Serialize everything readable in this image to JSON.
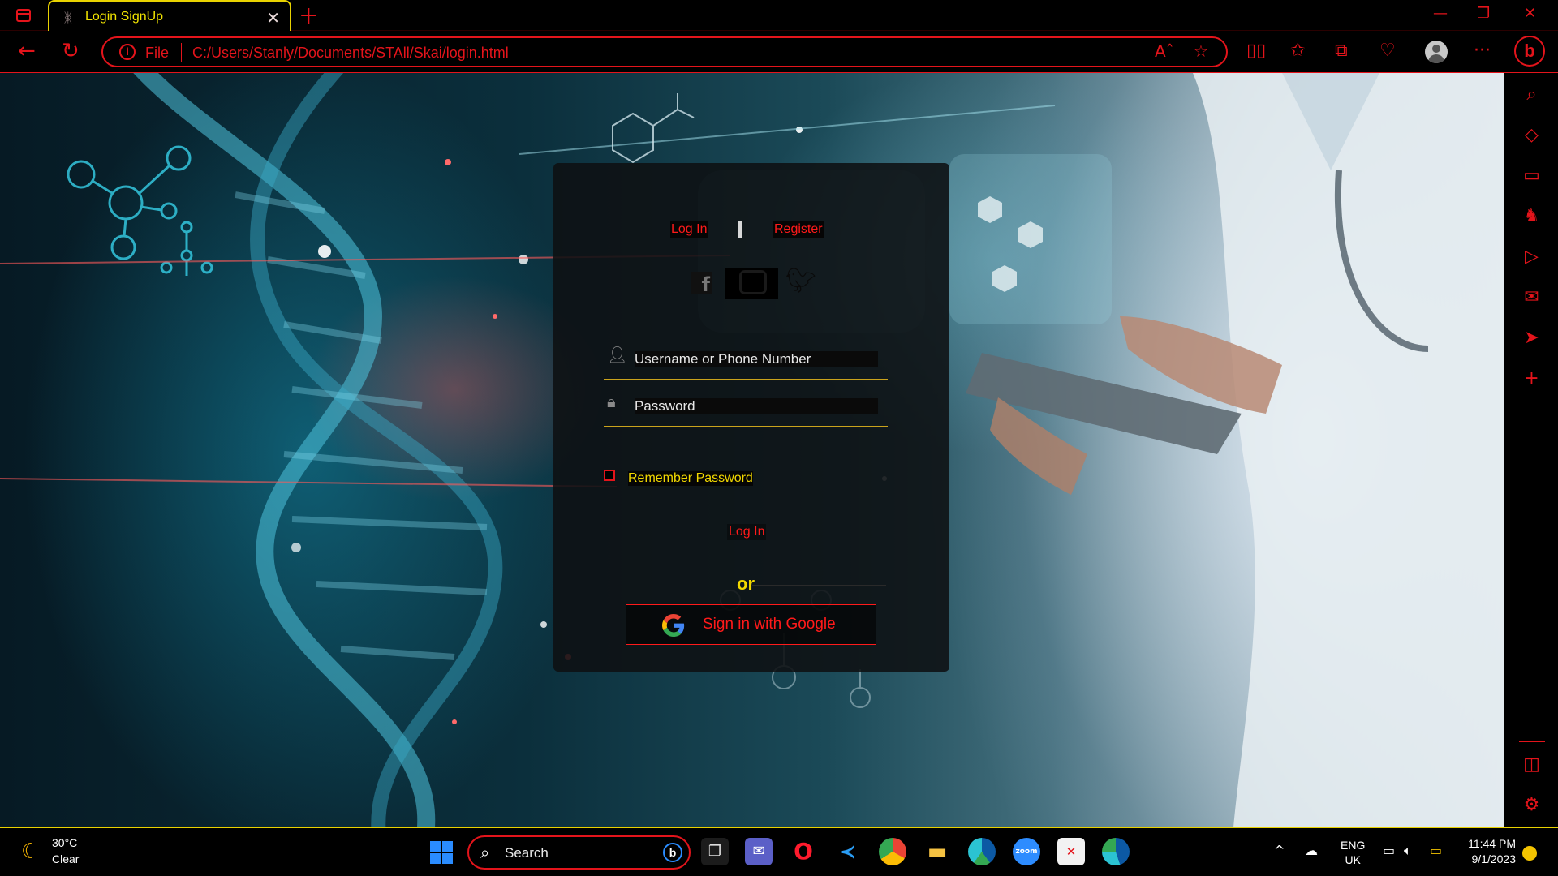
{
  "browser": {
    "tab_title": "Login SignUp",
    "address_prefix": "File",
    "url": "C:/Users/Stanly/Documents/STAll/Skai/login.html"
  },
  "login_card": {
    "tabs": [
      {
        "label": "Log In"
      },
      {
        "label": "Register"
      }
    ],
    "social": [
      "facebook-icon",
      "instagram-icon",
      "twitter-icon"
    ],
    "username_placeholder": "Username or Phone Number",
    "password_placeholder": "Password",
    "remember_label": "Remember Password",
    "login_button": "Log In",
    "or_text": "or",
    "google_button": "Sign in with Google"
  },
  "taskbar": {
    "weather_temp": "30°C",
    "weather_condition": "Clear",
    "search_label": "Search",
    "language": "ENG",
    "region": "UK",
    "time": "11:44 PM",
    "date": "9/1/2023"
  },
  "colors": {
    "accent_red": "#e4141b",
    "accent_yellow": "#f2d800",
    "card_bg": "#0e1012"
  }
}
